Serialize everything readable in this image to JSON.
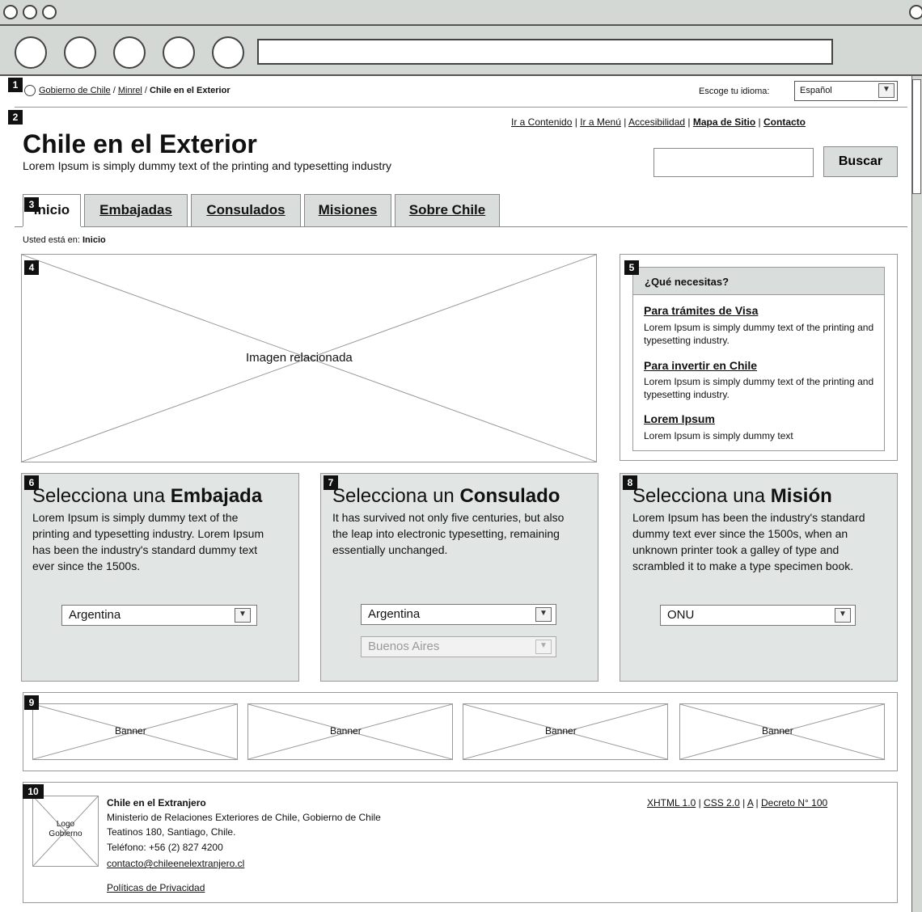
{
  "breadcrumb_top": {
    "item1": "Gobierno de Chile",
    "sep1": " / ",
    "item2": "Minrel",
    "sep2": " / ",
    "item3": "Chile en el Exterior"
  },
  "language": {
    "label": "Escoge tu idioma:",
    "selected": "Español"
  },
  "utility_links": [
    "Ir a Contenido",
    "Ir a Menú",
    "Accesibilidad",
    "Mapa de Sitio",
    "Contacto"
  ],
  "site": {
    "title": "Chile en el Exterior",
    "tagline": "Lorem Ipsum is simply dummy text of the printing and typesetting industry"
  },
  "search": {
    "button": "Buscar"
  },
  "tabs": [
    "Inicio",
    "Embajadas",
    "Consulados",
    "Misiones",
    "Sobre Chile"
  ],
  "location": {
    "prefix": "Usted está en:",
    "current": "Inicio"
  },
  "hero": {
    "caption": "Imagen relacionada"
  },
  "need": {
    "header": "¿Qué necesitas?",
    "items": [
      {
        "title": "Para trámites de Visa",
        "desc": "Lorem Ipsum is simply dummy text of the printing and typesetting industry."
      },
      {
        "title": "Para invertir en Chile",
        "desc": "Lorem Ipsum is simply dummy text of the printing and typesetting industry."
      },
      {
        "title": "Lorem Ipsum",
        "desc": "Lorem Ipsum is simply dummy text"
      }
    ]
  },
  "embajada": {
    "title_pre": "Selecciona una ",
    "title_bold": "Embajada",
    "desc": "Lorem Ipsum is simply dummy text of the printing and typesetting industry. Lorem Ipsum has been the industry's standard dummy text ever since the 1500s.",
    "select": "Argentina"
  },
  "consulado": {
    "title_pre": "Selecciona un ",
    "title_bold": "Consulado",
    "desc": "It has survived not only five centuries, but also the leap into electronic typesetting, remaining essentially unchanged.",
    "select1": "Argentina",
    "select2": "Buenos Aires"
  },
  "mision": {
    "title_pre": "Selecciona una ",
    "title_bold": "Misión",
    "desc": "Lorem Ipsum has been the industry's standard dummy text ever since the 1500s, when an unknown printer took a galley of type and scrambled it to make a type specimen book.",
    "select": "ONU"
  },
  "banners": [
    "Banner",
    "Banner",
    "Banner",
    "Banner"
  ],
  "footer": {
    "logo_line1": "Logo",
    "logo_line2": "Gobierno",
    "org": "Chile en el Extranjero",
    "ministry": "Ministerio de Relaciones Exteriores de Chile, Gobierno de Chile",
    "address": "Teatinos 180, Santiago, Chile.",
    "phone": "Teléfono: +56 (2) 827 4200",
    "email": "contacto@chileenelextranjero.cl",
    "privacy": "Políticas de Privacidad",
    "links": [
      "XHTML 1.0",
      "CSS 2.0",
      "A",
      "Decreto N° 100"
    ]
  },
  "markers": [
    "1",
    "2",
    "3",
    "4",
    "5",
    "6",
    "7",
    "8",
    "9",
    "10"
  ]
}
